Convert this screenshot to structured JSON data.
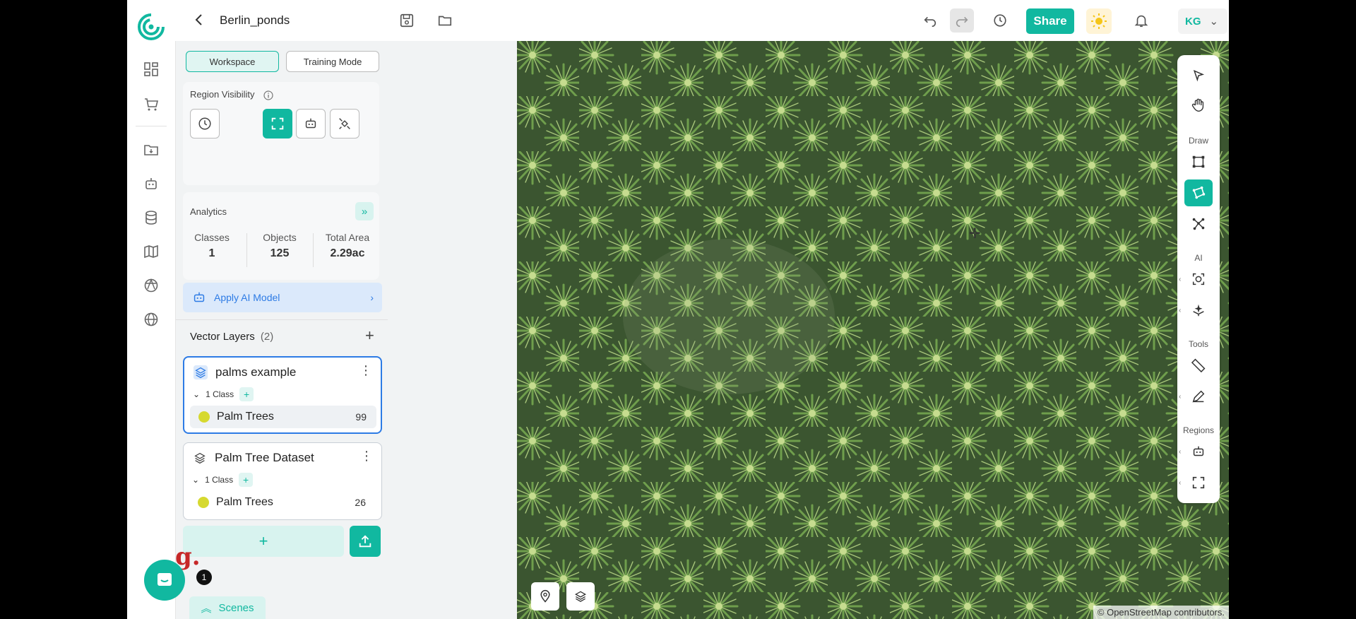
{
  "app": {
    "project_title": "Berlin_ponds",
    "share_label": "Share",
    "user_initials": "KG"
  },
  "panel": {
    "tabs": [
      {
        "label": "Workspace",
        "active": true
      },
      {
        "label": "Training Mode",
        "active": false
      }
    ],
    "region_visibility_label": "Region Visibility",
    "analytics": {
      "label": "Analytics",
      "stats": [
        {
          "label": "Classes",
          "value": "1"
        },
        {
          "label": "Objects",
          "value": "125"
        },
        {
          "label": "Total Area",
          "value": "2.29ac"
        }
      ]
    },
    "apply_ai_label": "Apply AI Model",
    "vector_layers": {
      "label": "Vector Layers",
      "count": "(2)",
      "layers": [
        {
          "name": "palms example",
          "class_count": "1 Class",
          "class_name": "Palm Trees",
          "object_count": "99",
          "dot_color": "#d6d930"
        },
        {
          "name": "Palm Tree Dataset",
          "class_count": "1 Class",
          "class_name": "Palm Trees",
          "object_count": "26",
          "dot_color": "#d6d930"
        }
      ]
    },
    "scenes_label": "Scenes",
    "chat_badge": "1",
    "add_layer_plus": "+"
  },
  "toolbar": {
    "sections": {
      "draw": "Draw",
      "ai": "AI",
      "tools": "Tools",
      "regions": "Regions"
    }
  },
  "map": {
    "attribution": "© OpenStreetMap contributors."
  },
  "colors": {
    "accent": "#11b8a0",
    "link_blue": "#2d7be5",
    "class_dot": "#d6d930"
  }
}
